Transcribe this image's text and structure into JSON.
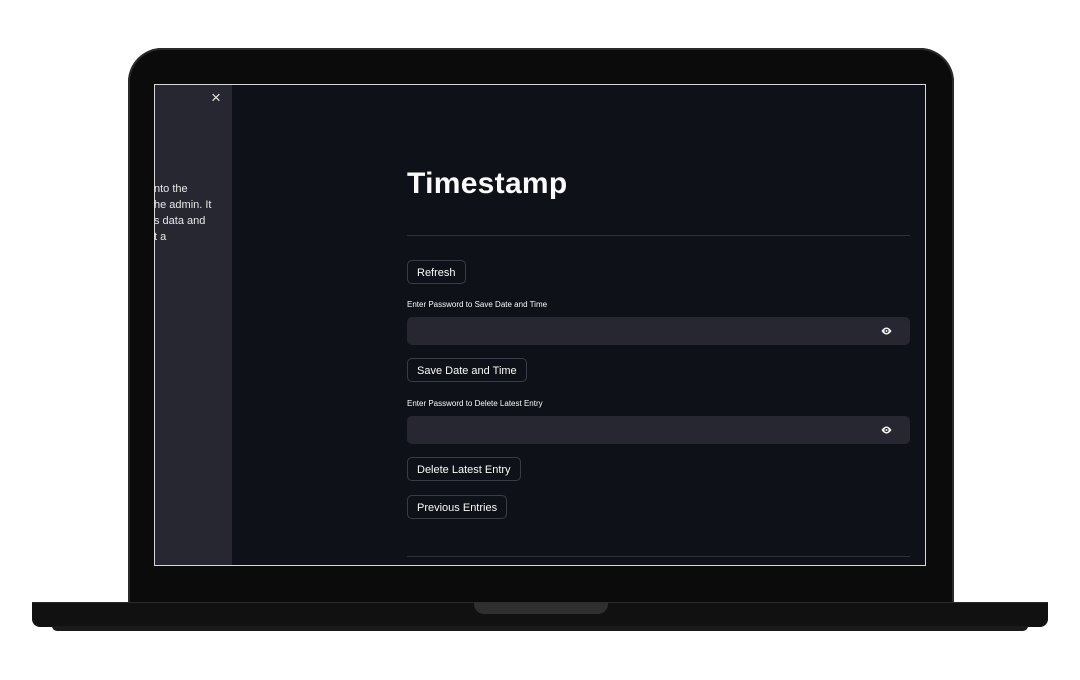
{
  "sidebar": {
    "close_glyph": "×",
    "text_lines": [
      "nto the",
      "he admin. It",
      "s data and",
      "t a"
    ]
  },
  "main": {
    "title": "Timestamp",
    "refresh_label": "Refresh",
    "save_password": {
      "label": "Enter Password to Save Date and Time",
      "value": ""
    },
    "save_button_label": "Save Date and Time",
    "delete_password": {
      "label": "Enter Password to Delete Latest Entry",
      "value": ""
    },
    "delete_button_label": "Delete Latest Entry",
    "previous_button_label": "Previous Entries"
  },
  "icons": {
    "close": "close-icon",
    "eye": "eye-icon"
  },
  "colors": {
    "app_background": "#0e1117",
    "sidebar_background": "#262730",
    "input_background": "#262730",
    "text": "#fafafa"
  }
}
